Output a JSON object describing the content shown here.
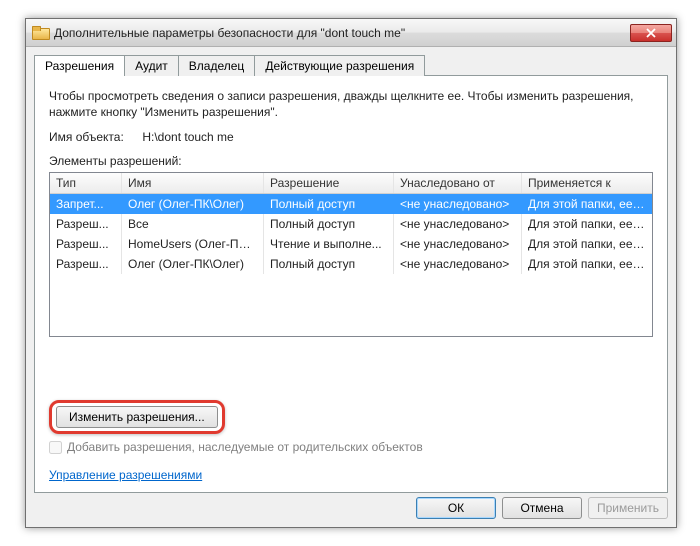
{
  "window": {
    "title": "Дополнительные параметры безопасности  для  \"dont touch me\""
  },
  "tabs": {
    "permissions": "Разрешения",
    "audit": "Аудит",
    "owner": "Владелец",
    "effective": "Действующие разрешения"
  },
  "intro": "Чтобы просмотреть сведения о записи разрешения, дважды щелкните ее. Чтобы изменить разрешения, нажмите кнопку \"Изменить разрешения\".",
  "object": {
    "label": "Имя объекта:",
    "value": "H:\\dont touch me"
  },
  "list": {
    "label": "Элементы разрешений:",
    "headers": {
      "type": "Тип",
      "name": "Имя",
      "permission": "Разрешение",
      "inherited": "Унаследовано от",
      "applies": "Применяется к"
    },
    "rows": [
      {
        "type": "Запрет...",
        "name": "Олег (Олег-ПК\\Олег)",
        "permission": "Полный доступ",
        "inherited": "<не унаследовано>",
        "applies": "Для этой папки, ее под...",
        "selected": true
      },
      {
        "type": "Разреш...",
        "name": "Все",
        "permission": "Полный доступ",
        "inherited": "<не унаследовано>",
        "applies": "Для этой папки, ее под...",
        "selected": false
      },
      {
        "type": "Разреш...",
        "name": "HomeUsers (Олег-ПК\\H...",
        "permission": "Чтение и выполне...",
        "inherited": "<не унаследовано>",
        "applies": "Для этой папки, ее под...",
        "selected": false
      },
      {
        "type": "Разреш...",
        "name": "Олег (Олег-ПК\\Олег)",
        "permission": "Полный доступ",
        "inherited": "<не унаследовано>",
        "applies": "Для этой папки, ее под...",
        "selected": false
      }
    ]
  },
  "buttons": {
    "change": "Изменить разрешения...",
    "ok": "ОК",
    "cancel": "Отмена",
    "apply": "Применить"
  },
  "checkbox": {
    "label": "Добавить разрешения, наследуемые от родительских объектов"
  },
  "link": "Управление разрешениями"
}
